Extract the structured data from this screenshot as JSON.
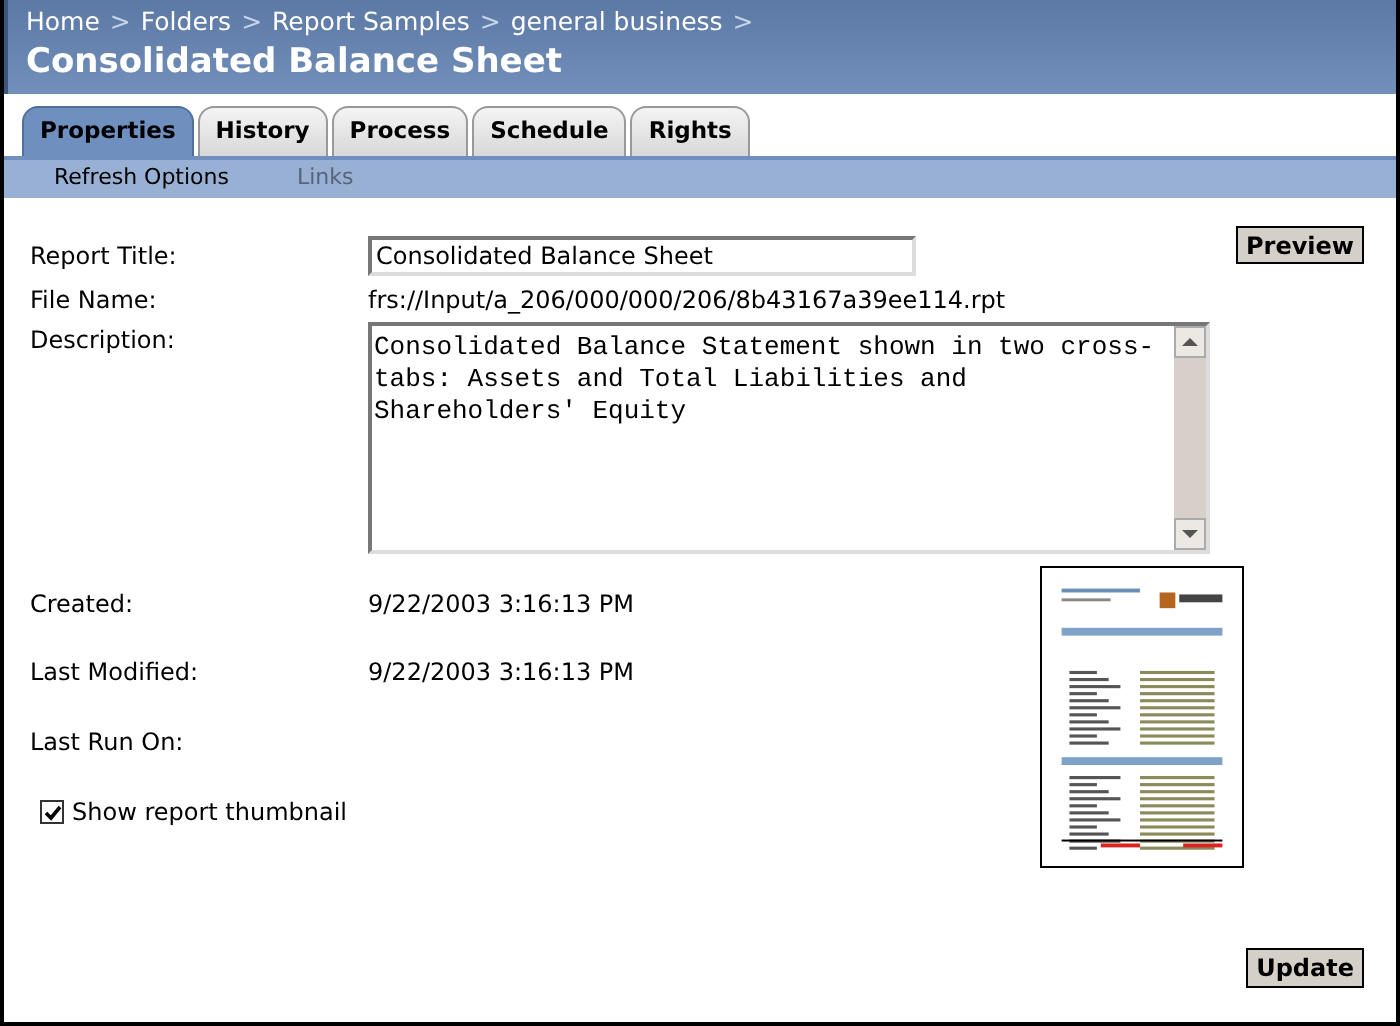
{
  "breadcrumb": {
    "items": [
      "Home",
      "Folders",
      "Report Samples",
      "general business"
    ],
    "separator": ">"
  },
  "page_title": "Consolidated Balance Sheet",
  "tabs": [
    {
      "label": "Properties",
      "selected": true
    },
    {
      "label": "History",
      "selected": false
    },
    {
      "label": "Process",
      "selected": false
    },
    {
      "label": "Schedule",
      "selected": false
    },
    {
      "label": "Rights",
      "selected": false
    }
  ],
  "subtabs": [
    {
      "label": "Refresh Options",
      "disabled": false
    },
    {
      "label": "Links",
      "disabled": true
    }
  ],
  "form": {
    "report_title": {
      "label": "Report Title:",
      "value": "Consolidated Balance Sheet"
    },
    "file_name": {
      "label": "File Name:",
      "value": "frs://Input/a_206/000/000/206/8b43167a39ee114.rpt"
    },
    "description": {
      "label": "Description:",
      "value": "Consolidated Balance Statement shown in two cross-tabs: Assets and Total Liabilities and Shareholders' Equity"
    },
    "created": {
      "label": "Created:",
      "value": "9/22/2003 3:16:13 PM"
    },
    "last_modified": {
      "label": "Last Modified:",
      "value": "9/22/2003 3:16:13 PM"
    },
    "last_run_on": {
      "label": "Last Run On:"
    }
  },
  "show_thumbnail": {
    "label": "Show report thumbnail",
    "checked": true
  },
  "buttons": {
    "preview": "Preview",
    "update": "Update"
  }
}
